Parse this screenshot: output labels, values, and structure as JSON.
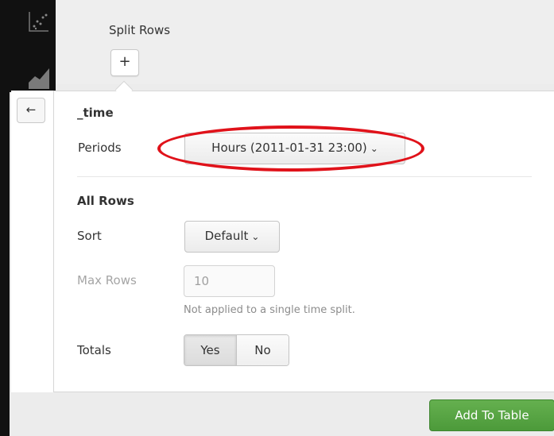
{
  "split_rows": {
    "title": "Split Rows",
    "add_symbol": "+"
  },
  "panel": {
    "back_symbol": "←",
    "field_name": "_time",
    "periods": {
      "label": "Periods",
      "value": "Hours (2011-01-31 23:00)"
    },
    "all_rows_heading": "All Rows",
    "sort": {
      "label": "Sort",
      "value": "Default"
    },
    "max_rows": {
      "label": "Max Rows",
      "value": "10",
      "hint": "Not applied to a single time split."
    },
    "totals": {
      "label": "Totals",
      "options": [
        "Yes",
        "No"
      ],
      "selected": "Yes"
    }
  },
  "actions": {
    "add_to_table": "Add To Table"
  },
  "icons": {
    "back": "arrow-left-icon",
    "add": "plus-icon",
    "dropdown": "chevron-down-icon",
    "rail": [
      "scatter-chart-icon",
      "area-chart-icon"
    ]
  },
  "colors": {
    "accent_green": "#5aa545",
    "annotation_red": "#e0121a"
  }
}
